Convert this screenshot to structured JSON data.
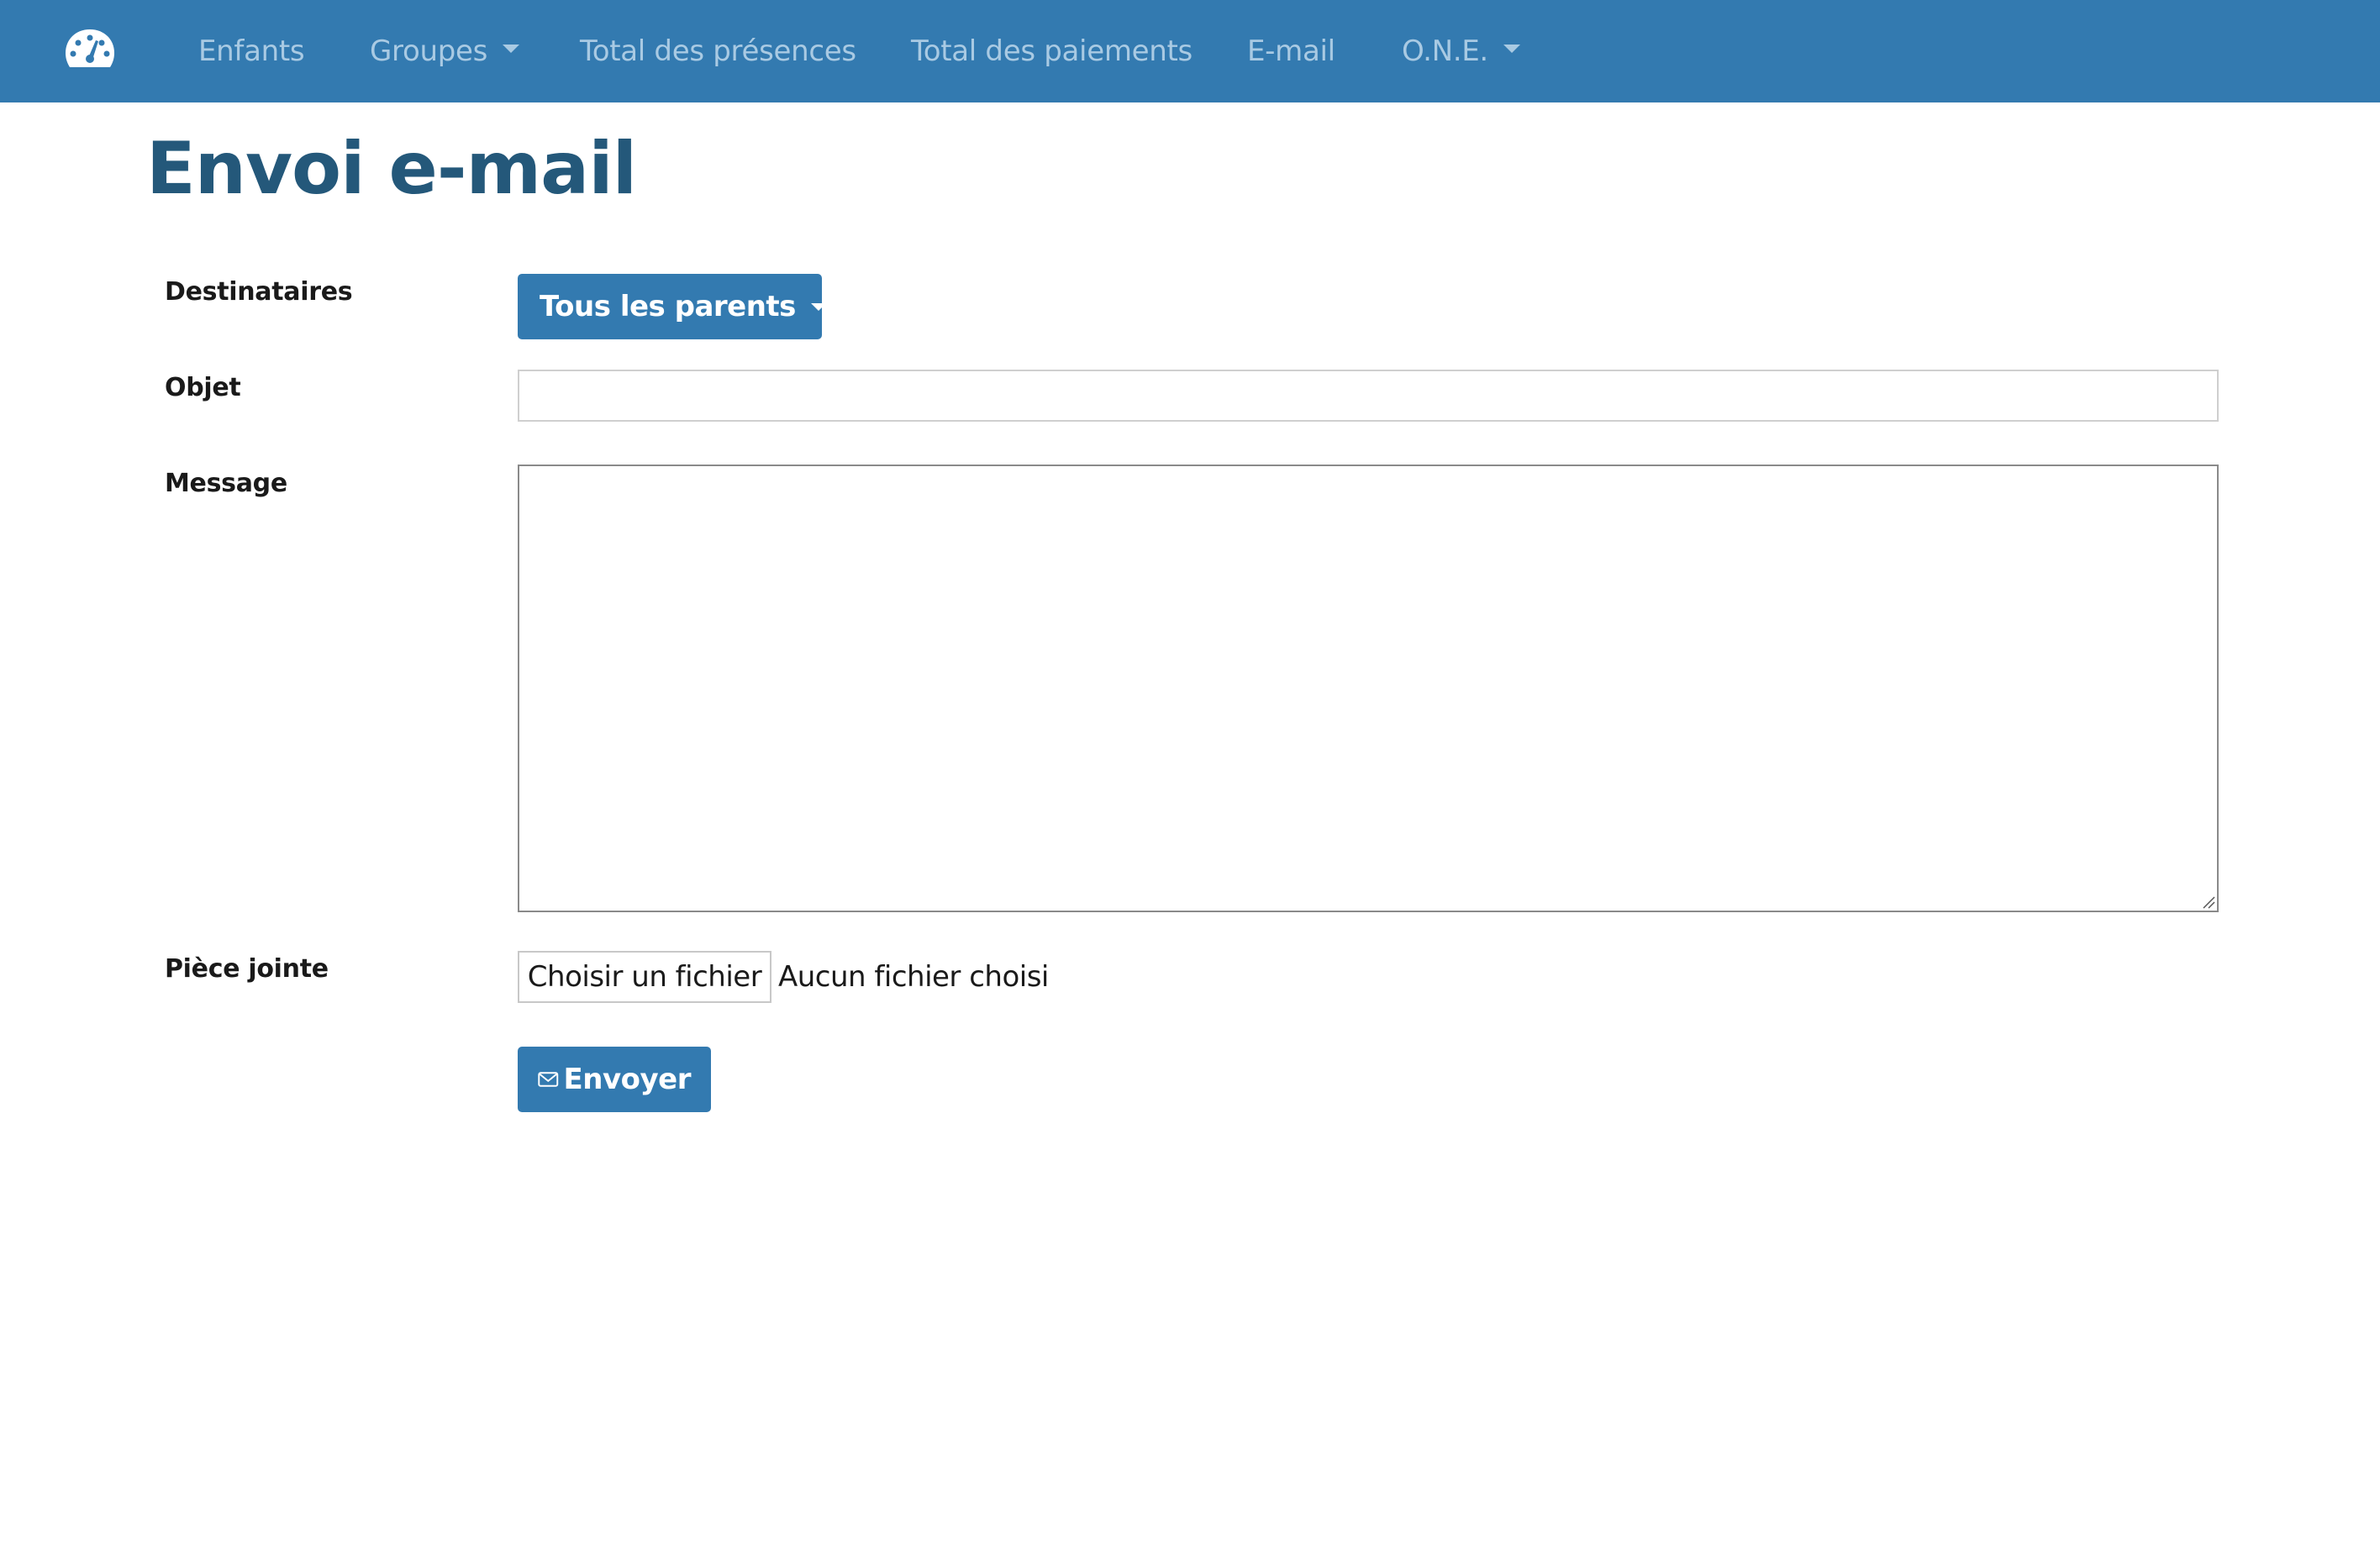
{
  "navbar": {
    "brand_icon": "dashboard-gauge-icon",
    "items": [
      {
        "label": "Enfants",
        "dropdown": false
      },
      {
        "label": "Groupes",
        "dropdown": true
      },
      {
        "label": "Total des présences",
        "dropdown": false
      },
      {
        "label": "Total des paiements",
        "dropdown": false
      },
      {
        "label": "E-mail",
        "dropdown": false
      },
      {
        "label": "O.N.E.",
        "dropdown": true
      }
    ],
    "background_color": "#337ab0",
    "text_color": "#a9cae3"
  },
  "page": {
    "title": "Envoi e-mail",
    "title_color": "#24587a"
  },
  "form": {
    "recipients": {
      "label": "Destinataires",
      "selected": "Tous les parents"
    },
    "subject": {
      "label": "Objet",
      "value": ""
    },
    "message": {
      "label": "Message",
      "value": ""
    },
    "attachment": {
      "label": "Pièce jointe",
      "button_label": "Choisir un fichier",
      "status": "Aucun fichier choisi"
    },
    "submit": {
      "label": "Envoyer",
      "icon": "envelope-icon"
    }
  }
}
